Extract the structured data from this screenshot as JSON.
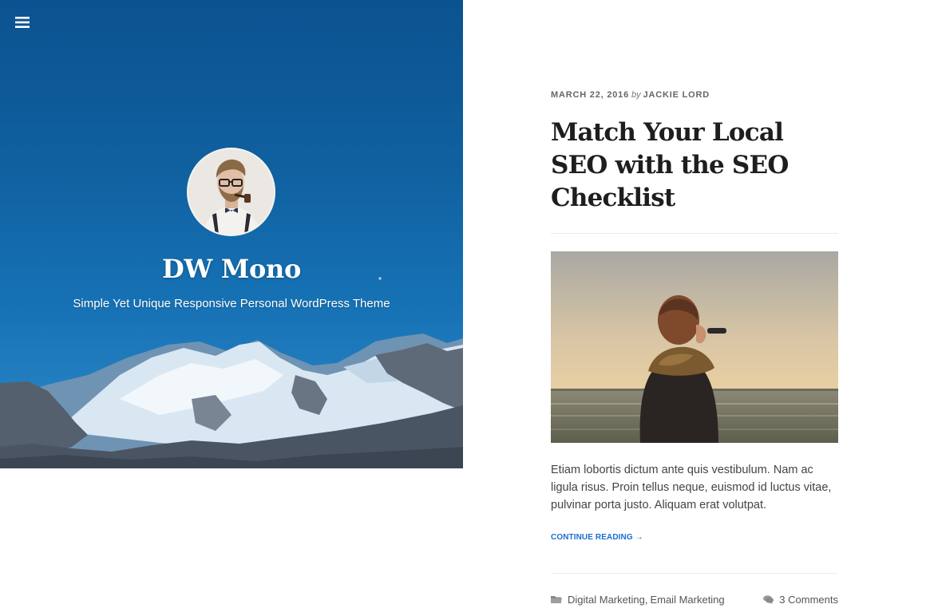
{
  "header": {
    "menu_icon": "hamburger-menu-icon",
    "site_title": "DW Mono",
    "tagline": "Simple Yet Unique Responsive Personal WordPress Theme"
  },
  "post": {
    "date": "MARCH 22, 2016",
    "by": "by",
    "author": "JACKIE LORD",
    "title": "Match Your Local SEO with the SEO Checklist",
    "excerpt": "Etiam lobortis dictum ante quis vestibulum. Nam ac ligula risus. Proin tellus neque, euismod id luctus vitae, pulvinar porta justo. Aliquam erat volutpat.",
    "continue_label": "CONTINUE READING →",
    "categories": [
      "Digital Marketing",
      "Email Marketing"
    ],
    "category_separator": ",",
    "comments": "3 Comments"
  },
  "colors": {
    "accent": "#1b6ed1",
    "hero_blue": "#10609f",
    "title_text": "#1e1e1e",
    "body_text": "#444444"
  }
}
